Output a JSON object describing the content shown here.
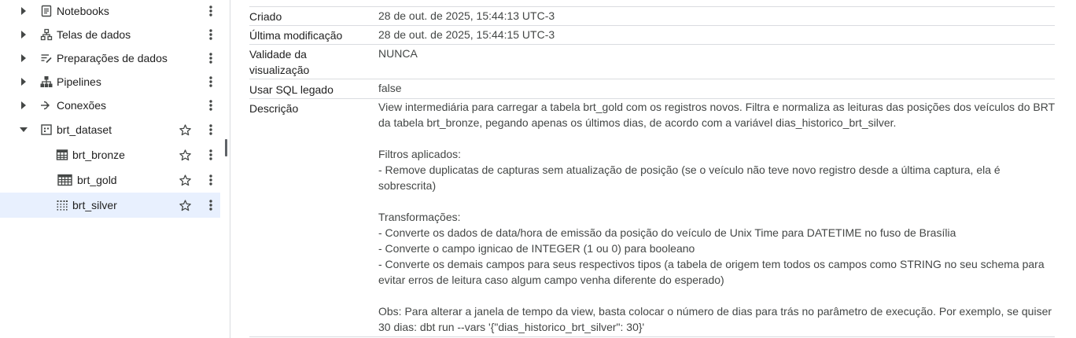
{
  "sidebar": {
    "items": [
      {
        "label": "Notebooks",
        "icon": "notebook-icon",
        "expanded": false
      },
      {
        "label": "Telas de dados",
        "icon": "data-canvas-icon",
        "expanded": false
      },
      {
        "label": "Preparações de dados",
        "icon": "data-preparation-icon",
        "expanded": false
      },
      {
        "label": "Pipelines",
        "icon": "pipeline-icon",
        "expanded": false
      },
      {
        "label": "Conexões",
        "icon": "connection-icon",
        "expanded": false
      },
      {
        "label": "brt_dataset",
        "icon": "dataset-icon",
        "expanded": true
      }
    ],
    "children": [
      {
        "label": "brt_bronze",
        "icon": "table-icon"
      },
      {
        "label": "brt_gold",
        "icon": "table-icon"
      },
      {
        "label": "brt_silver",
        "icon": "view-icon",
        "selected": true
      }
    ]
  },
  "details": {
    "rows": [
      {
        "key": "Criado",
        "value": "28 de out. de 2025, 15:44:13 UTC-3"
      },
      {
        "key": "Última modificação",
        "value": "28 de out. de 2025, 15:44:15 UTC-3"
      },
      {
        "key_lines": [
          "Validade da",
          "visualização"
        ],
        "value": "NUNCA"
      },
      {
        "key": "Usar SQL legado",
        "value": "false"
      }
    ],
    "description": {
      "key": "Descrição",
      "lines": [
        "View intermediária para carregar a tabela brt_gold com os registros novos. Filtra e normaliza as leituras das posições dos veículos do BRT",
        "da tabela brt_bronze, pegando apenas os últimos dias, de acordo com a variável dias_historico_brt_silver.",
        "",
        "Filtros aplicados:",
        "- Remove duplicatas de capturas sem atualização de posição (se o veículo não teve novo registro desde a última captura, ela é",
        "sobrescrita)",
        "",
        "Transformações:",
        "- Converte os dados de data/hora de emissão da posição do veículo de Unix Time para DATETIME no fuso de Brasília",
        "- Converte o campo ignicao de INTEGER (1 ou 0) para booleano",
        "- Converte os demais campos para seus respectivos tipos (a tabela de origem tem todos os campos como STRING no seu schema para",
        "evitar erros de leitura caso algum campo venha diferente do esperado)",
        "",
        "Obs: Para alterar a janela de tempo da view, basta colocar o número de dias para trás no parâmetro de execução. Por exemplo, se quiser",
        "30 dias: dbt run --vars '{\"dias_historico_brt_silver\": 30}'"
      ]
    }
  },
  "colors": {
    "selected_bg": "#e8f0fe",
    "divider": "#dadce0",
    "icon": "#444746",
    "text": "#1f1f1f",
    "value_text": "#444746"
  }
}
